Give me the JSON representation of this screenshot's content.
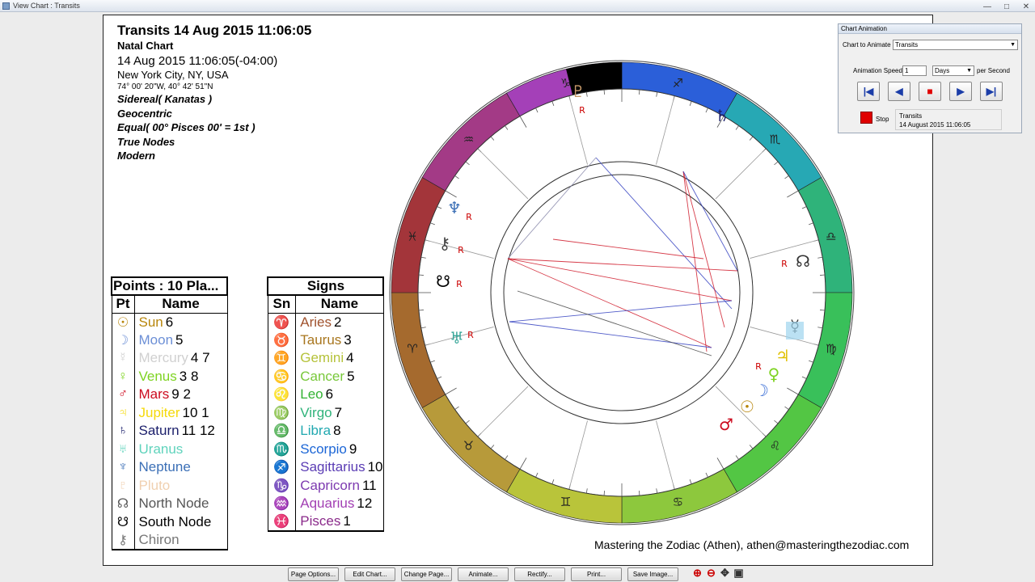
{
  "window": {
    "title": "View Chart : Transits"
  },
  "header": {
    "title": "Transits 14 Aug 2015 11:06:05",
    "subtitle": "Natal Chart",
    "datetime": "14 Aug 2015 11:06:05(-04:00)",
    "place": "New York City, NY, USA",
    "coords": "74° 00' 20\"W, 40° 42' 51\"N",
    "settings": [
      "Sidereal( Kanatas )",
      "Geocentric",
      "Equal( 00° Pisces 00' = 1st )",
      "True Nodes",
      "Modern"
    ]
  },
  "points_table": {
    "caption": "Points : 10 Pla...",
    "col_pt": "Pt",
    "col_name": "Name",
    "rows": [
      {
        "glyph": "☉",
        "name": "Sun",
        "num": "6",
        "color": "#b8860b"
      },
      {
        "glyph": "☽",
        "name": "Moon",
        "num": "5",
        "color": "#6c8fd6"
      },
      {
        "glyph": "☿",
        "name": "Mercury",
        "num": "4 7",
        "color": "#d0d0d0"
      },
      {
        "glyph": "♀",
        "name": "Venus",
        "num": "3  8",
        "color": "#7ed321"
      },
      {
        "glyph": "♂",
        "name": "Mars",
        "num": "9  2",
        "color": "#cc0a1e"
      },
      {
        "glyph": "♃",
        "name": "Jupiter",
        "num": "10  1",
        "color": "#f5d90a"
      },
      {
        "glyph": "♄",
        "name": "Saturn",
        "num": "11 12",
        "color": "#1b1f6b"
      },
      {
        "glyph": "♅",
        "name": "Uranus",
        "num": "",
        "color": "#5fd3bc"
      },
      {
        "glyph": "♆",
        "name": "Neptune",
        "num": "",
        "color": "#3b6fb6"
      },
      {
        "glyph": "♇",
        "name": "Pluto",
        "num": "",
        "color": "#f0d0b0"
      },
      {
        "glyph": "☊",
        "name": "North Node",
        "num": "",
        "color": "#555555"
      },
      {
        "glyph": "☋",
        "name": "South Node",
        "num": "",
        "color": "#000000"
      },
      {
        "glyph": "⚷",
        "name": "Chiron",
        "num": "",
        "color": "#777777"
      }
    ]
  },
  "signs_table": {
    "caption": "Signs",
    "col_sn": "Sn",
    "col_name": "Name",
    "rows": [
      {
        "glyph": "♈",
        "name": "Aries",
        "num": "2",
        "color": "#a0522d"
      },
      {
        "glyph": "♉",
        "name": "Taurus",
        "num": "3",
        "color": "#a8761e"
      },
      {
        "glyph": "♊",
        "name": "Gemini",
        "num": "4",
        "color": "#b5c23a"
      },
      {
        "glyph": "♋",
        "name": "Cancer",
        "num": "5",
        "color": "#78c83a"
      },
      {
        "glyph": "♌",
        "name": "Leo",
        "num": "6",
        "color": "#33b233"
      },
      {
        "glyph": "♍",
        "name": "Virgo",
        "num": "7",
        "color": "#2fb37a"
      },
      {
        "glyph": "♎",
        "name": "Libra",
        "num": "8",
        "color": "#21a8b0"
      },
      {
        "glyph": "♏",
        "name": "Scorpio",
        "num": "9",
        "color": "#1c66d6"
      },
      {
        "glyph": "♐",
        "name": "Sagittarius",
        "num": "10",
        "color": "#5a3cb4"
      },
      {
        "glyph": "♑",
        "name": "Capricorn",
        "num": "11",
        "color": "#7d3ab0"
      },
      {
        "glyph": "♒",
        "name": "Aquarius",
        "num": "12",
        "color": "#a23fb3"
      },
      {
        "glyph": "♓",
        "name": "Pisces",
        "num": "1",
        "color": "#8a2a8a"
      }
    ]
  },
  "wheel": {
    "outer_signs": [
      "♐",
      "♏",
      "♎",
      "♍",
      "♌",
      "♋",
      "♊",
      "♉",
      "♈",
      "♓",
      "♒",
      "♑"
    ],
    "outer_planets": [
      {
        "glyph": "♇",
        "name": "Pluto",
        "retro": "R",
        "color": "#c79a6a"
      },
      {
        "glyph": "♄",
        "name": "Saturn",
        "retro": "",
        "color": "#1b1f6b"
      },
      {
        "glyph": "♆",
        "name": "Neptune",
        "retro": "R",
        "color": "#3b6fb6"
      },
      {
        "glyph": "⚷",
        "name": "Chiron",
        "retro": "R",
        "color": "#444444"
      },
      {
        "glyph": "☋",
        "name": "South Node",
        "retro": "R",
        "color": "#000000"
      },
      {
        "glyph": "♅",
        "name": "Uranus",
        "retro": "R",
        "color": "#3aa79a"
      },
      {
        "glyph": "☊",
        "name": "North Node",
        "retro": "R",
        "color": "#333333"
      },
      {
        "glyph": "☿",
        "name": "Mercury",
        "retro": "",
        "color": "#3a3a3a"
      },
      {
        "glyph": "♃",
        "name": "Jupiter",
        "retro": "",
        "color": "#e0c000"
      },
      {
        "glyph": "♀",
        "name": "Venus",
        "retro": "R",
        "color": "#7ed321"
      },
      {
        "glyph": "☽",
        "name": "Moon",
        "retro": "",
        "color": "#3b6fd6"
      },
      {
        "glyph": "☉",
        "name": "Sun",
        "retro": "",
        "color": "#b8860b"
      },
      {
        "glyph": "♂",
        "name": "Mars",
        "retro": "",
        "color": "#cc0a1e"
      }
    ]
  },
  "credit": "Mastering the Zodiac (Athen), athen@masteringthezodiac.com",
  "toolbar": {
    "buttons": [
      "Page Options...",
      "Edit Chart...",
      "Change Page...",
      "Animate...",
      "Rectify...",
      "Print...",
      "Save Image..."
    ]
  },
  "animation_panel": {
    "title": "Chart Animation",
    "animate_label": "Chart to Animate :",
    "animate_value": "Transits",
    "speed_label": "Animation Speed :",
    "speed_value": "1",
    "unit_value": "Days",
    "per_label": "per Second",
    "stop_label": "Stop",
    "status_name": "Transits",
    "status_date": "14 August 2015 11:06:05"
  }
}
